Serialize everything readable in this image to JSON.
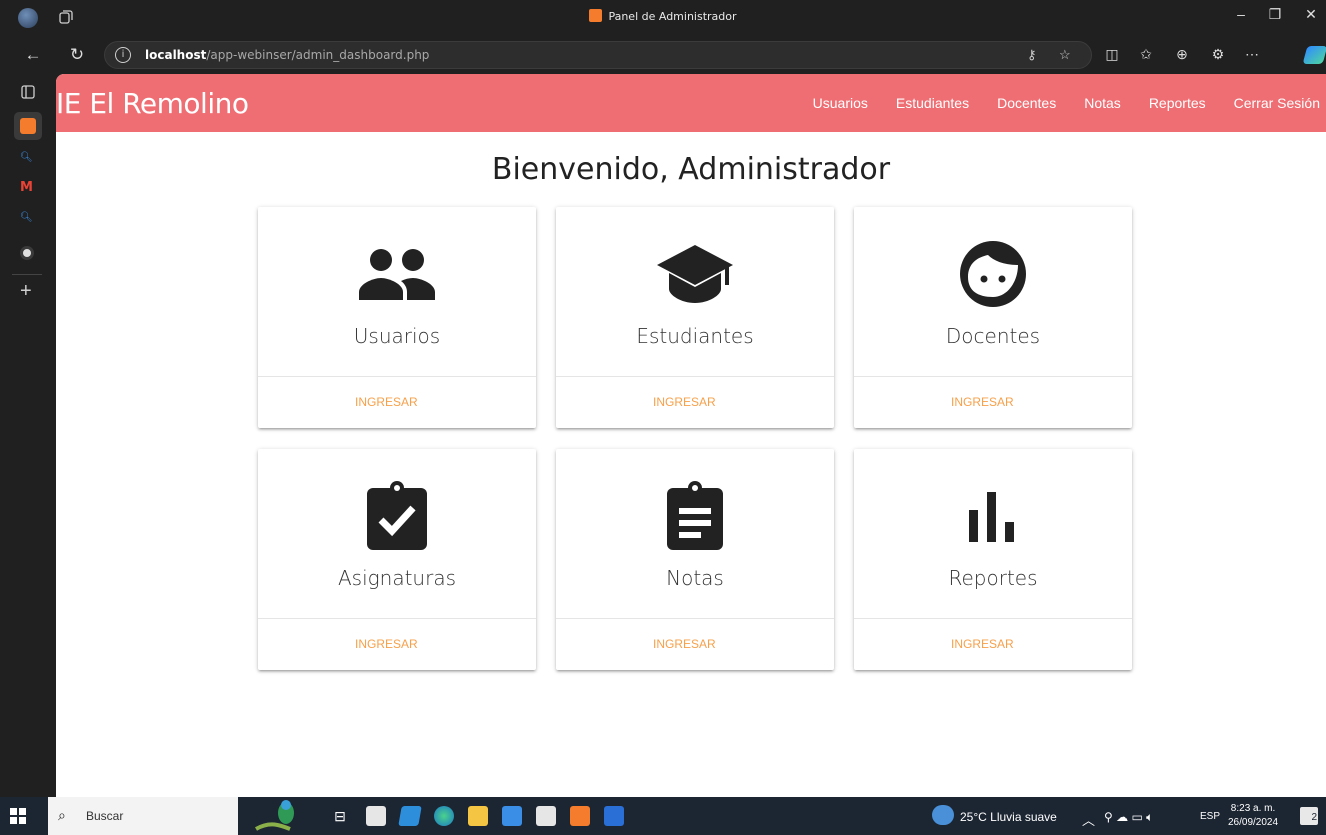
{
  "browser": {
    "window_title": "Panel de Administrador",
    "url_host": "localhost",
    "url_path": "/app-webinser/admin_dashboard.php"
  },
  "app": {
    "brand": "IE El Remolino",
    "nav": [
      {
        "label": "Usuarios"
      },
      {
        "label": "Estudiantes"
      },
      {
        "label": "Docentes"
      },
      {
        "label": "Notas"
      },
      {
        "label": "Reportes"
      },
      {
        "label": "Cerrar Sesión"
      }
    ],
    "accent_color": "#ee6e73",
    "link_color": "#f7a04a"
  },
  "main": {
    "welcome": "Bienvenido, Administrador",
    "cards": [
      {
        "title": "Usuarios",
        "action": "INGRESAR",
        "icon": "people-icon"
      },
      {
        "title": "Estudiantes",
        "action": "INGRESAR",
        "icon": "graduation-cap-icon"
      },
      {
        "title": "Docentes",
        "action": "INGRESAR",
        "icon": "face-icon"
      },
      {
        "title": "Asignaturas",
        "action": "INGRESAR",
        "icon": "clipboard-check-icon"
      },
      {
        "title": "Notas",
        "action": "INGRESAR",
        "icon": "clipboard-list-icon"
      },
      {
        "title": "Reportes",
        "action": "INGRESAR",
        "icon": "bar-chart-icon"
      }
    ]
  },
  "taskbar": {
    "search_placeholder": "Buscar",
    "weather": "25°C  Lluvia suave",
    "language": "ESP",
    "time": "8:23 a. m.",
    "date": "26/09/2024",
    "notification_count": "2"
  }
}
